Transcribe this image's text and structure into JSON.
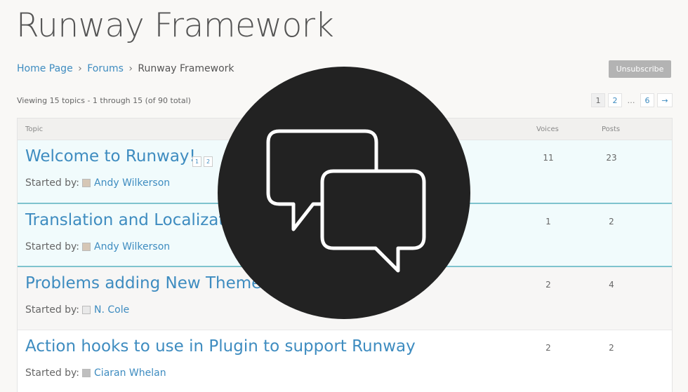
{
  "header": {
    "title": "Runway Framework"
  },
  "breadcrumb": {
    "home": "Home Page",
    "forums": "Forums",
    "current": "Runway Framework",
    "separator": "›"
  },
  "actions": {
    "unsubscribe": "Unsubscribe"
  },
  "listing": {
    "count_text": "Viewing 15 topics - 1 through 15 (of 90 total)"
  },
  "pagination": {
    "pages": [
      "1",
      "2",
      "…",
      "6"
    ],
    "current": "1",
    "next": "→"
  },
  "table": {
    "headers": {
      "topic": "Topic",
      "voices": "Voices",
      "posts": "Posts"
    },
    "started_by_label": "Started by:",
    "rows": [
      {
        "title": "Welcome to Runway!",
        "mini_pages": [
          "1",
          "2"
        ],
        "author": "Andy Wilkerson",
        "voices": "11",
        "posts": "23"
      },
      {
        "title": "Translation and Localizatio",
        "author": "Andy Wilkerson",
        "voices": "1",
        "posts": "2"
      },
      {
        "title": "Problems adding New Theme",
        "author": "N. Cole",
        "voices": "2",
        "posts": "4"
      },
      {
        "title": "Action hooks to use in Plugin to support Runway",
        "author": "Ciaran Whelan",
        "voices": "2",
        "posts": "2"
      }
    ]
  },
  "overlay": {
    "icon": "speech-bubbles-icon",
    "background": "#222222",
    "stroke": "#ffffff"
  },
  "colors": {
    "link": "#3e8cc0",
    "highlight_row": "#f1fbfc",
    "highlight_border": "#7fc3ce",
    "button": "#b3b3b3"
  }
}
